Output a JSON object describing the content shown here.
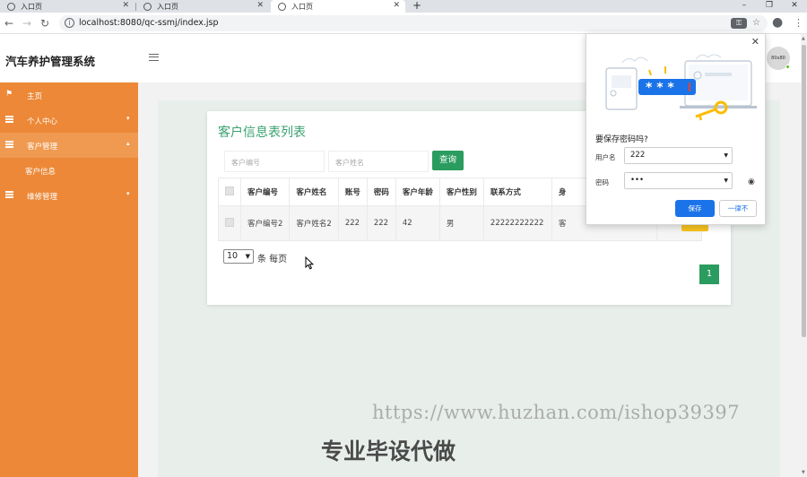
{
  "browser": {
    "tabs": [
      {
        "title": "入口页",
        "active": false
      },
      {
        "title": "入口页",
        "active": false
      },
      {
        "title": "入口页",
        "active": true
      }
    ],
    "new_tab": "+",
    "url": "localhost:8080/qc-ssmj/index.jsp",
    "window_controls": {
      "minimize": "–",
      "maximize": "❐",
      "close": "✕"
    }
  },
  "header": {
    "site_title": "汽车养护管理系统",
    "avatar_text": "80x80"
  },
  "sidebar": {
    "items": [
      {
        "label": "主页",
        "icon": "flag-icon"
      },
      {
        "label": "个人中心",
        "icon": "list-icon",
        "arrow": "▾"
      },
      {
        "label": "客户管理",
        "icon": "list-icon",
        "arrow": "▴",
        "open": true
      },
      {
        "label": "客户信息",
        "sub": true
      },
      {
        "label": "维修管理",
        "icon": "list-icon",
        "arrow": "▾"
      }
    ]
  },
  "card": {
    "title": "客户信息表列表",
    "search": {
      "placeholder_no": "客户编号",
      "placeholder_name": "客户姓名",
      "button": "查询"
    },
    "table": {
      "headers": [
        "客户编号",
        "客户姓名",
        "账号",
        "密码",
        "客户年龄",
        "客户性别",
        "联系方式",
        "身"
      ],
      "rows": [
        [
          "客户编号2",
          "客户姓名2",
          "222",
          "222",
          "42",
          "男",
          "22222222222",
          "客"
        ]
      ]
    },
    "pagination": {
      "page_size": "10",
      "per_page_text": "条 每页",
      "current_page": "1"
    }
  },
  "password_popup": {
    "title": "要保存密码吗?",
    "username_label": "用户名",
    "username_value": "222",
    "password_label": "密码",
    "password_value": "•••",
    "save": "保存",
    "never": "一律不",
    "close": "✕",
    "dots": "* * *"
  },
  "overlay": {
    "watermark": "https://www.huzhan.com/ishop39397",
    "slogan": "专业毕设代做"
  },
  "colors": {
    "sidebar": "#ec8837",
    "accent": "#2b9c5f",
    "primary_blue": "#1a73e8"
  }
}
